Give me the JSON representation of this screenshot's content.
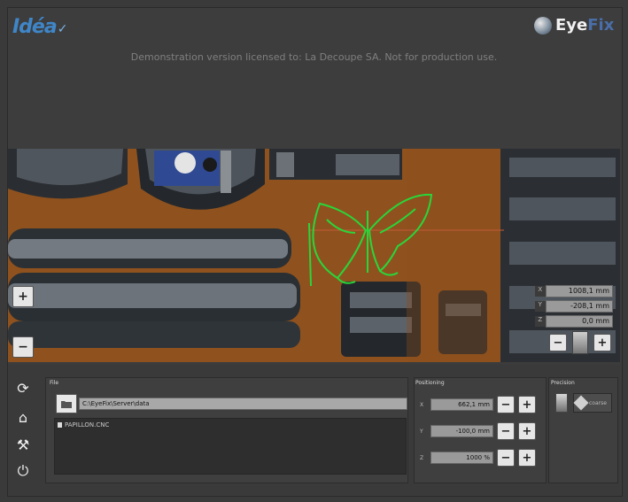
{
  "header": {
    "logo_left": "Idéa",
    "logo_right_part1": "Eye",
    "logo_right_part2": "Fix",
    "licence_text": "Demonstration version licensed to: La Decoupe SA. Not for production use."
  },
  "camera": {
    "coords": [
      {
        "axis": "X",
        "value": "1008,1 mm"
      },
      {
        "axis": "Y",
        "value": "-208,1 mm"
      },
      {
        "axis": "Z",
        "value": "0,0 mm"
      }
    ],
    "zoom_in_label": "+",
    "zoom_out_label": "−",
    "overlay_color": "#29d63a"
  },
  "file_panel": {
    "title": "File",
    "path": "C:\\EyeFix\\Server\\data",
    "files": [
      "PAPILLON.CNC"
    ]
  },
  "positioning": {
    "title": "Positioning",
    "rows": [
      {
        "axis": "X",
        "value": "662,1 mm"
      },
      {
        "axis": "Y",
        "value": "-100,0 mm"
      },
      {
        "axis": "Z",
        "value": "1000 %"
      }
    ]
  },
  "precision": {
    "title": "Precision",
    "mode_label": "coarse"
  },
  "sidebar": {
    "buttons": [
      {
        "name": "refresh",
        "glyph": "⟳"
      },
      {
        "name": "home",
        "glyph": "⌂"
      },
      {
        "name": "tools",
        "glyph": "⚒"
      },
      {
        "name": "power",
        "glyph": "⏻"
      }
    ]
  }
}
